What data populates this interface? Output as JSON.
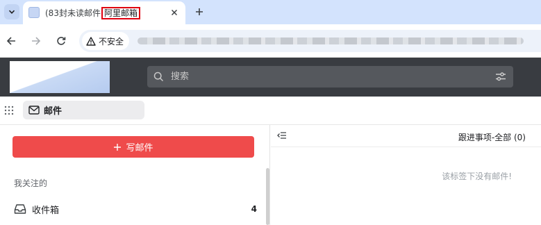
{
  "browser": {
    "tab": {
      "title_prefix": "(83封未读邮件",
      "title_highlight": "阿里邮箱"
    },
    "address": {
      "security_label": "不安全"
    }
  },
  "app": {
    "search": {
      "placeholder": "搜索"
    },
    "nav": {
      "mail_tab_label": "邮件"
    },
    "sidebar": {
      "compose_label": "写邮件",
      "section_label": "我关注的",
      "folders": [
        {
          "label": "收件箱",
          "count": "4"
        }
      ]
    },
    "right_pane": {
      "title": "跟进事项-全部 (0)",
      "empty_message": "该标签下没有邮件!"
    }
  },
  "colors": {
    "compose_button": "#ef4b4b",
    "header_bg": "#393c41",
    "tab_strip_bg": "#d3e3fd",
    "highlight_box": "#e0000f"
  },
  "icons": [
    "tab-list-icon",
    "favicon-icon",
    "close-icon",
    "plus-icon",
    "back-icon",
    "forward-icon",
    "reload-icon",
    "warning-icon",
    "search-icon",
    "filter-icon",
    "apps-grid-icon",
    "mail-icon",
    "plus-small-icon",
    "inbox-icon",
    "collapse-icon"
  ]
}
